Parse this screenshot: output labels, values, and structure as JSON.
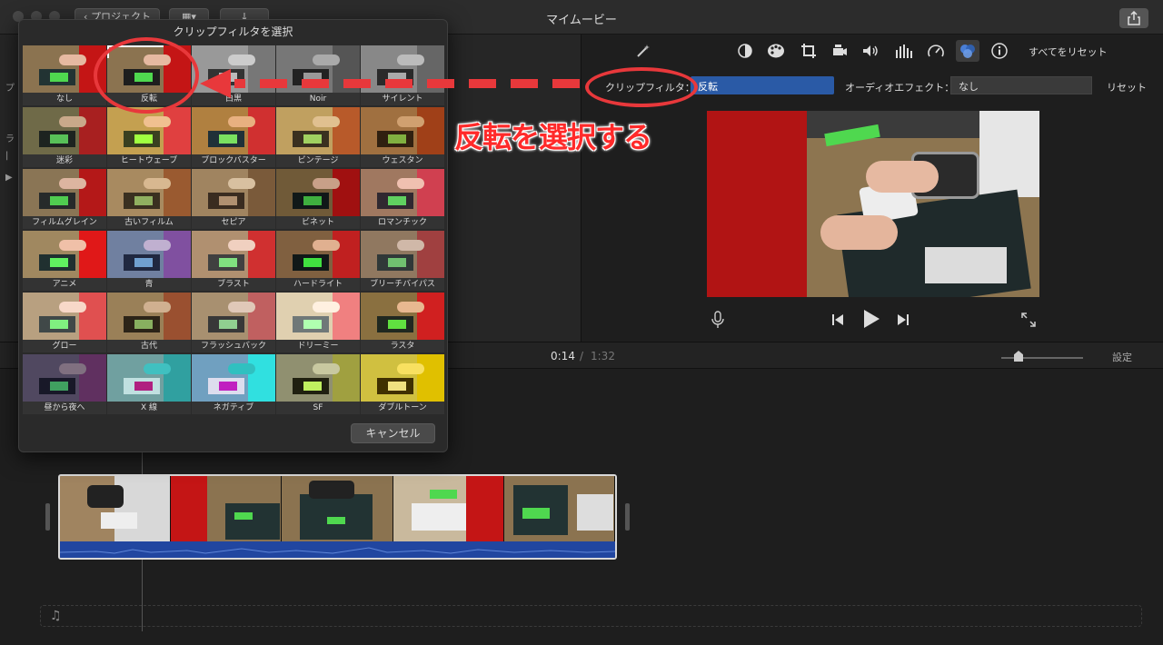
{
  "window": {
    "title": "マイムービー",
    "project_button": "プロジェクト"
  },
  "browser": {
    "side_labels": [
      "プ",
      "ラ",
      "|"
    ]
  },
  "toolbar": {
    "reset_all": "すべてをリセット",
    "icons": [
      "magic-wand-icon",
      "color-balance-icon",
      "color-palette-icon",
      "crop-icon",
      "stabilization-icon",
      "volume-icon",
      "equalizer-icon",
      "speed-icon",
      "clip-filter-icon",
      "info-icon"
    ]
  },
  "filter_bar": {
    "clip_filter_label": "クリップフィルタ：",
    "clip_filter_value": "反転",
    "audio_effect_label": "オーディオエフェクト：",
    "audio_effect_value": "なし",
    "reset_label": "リセット"
  },
  "timeline": {
    "current_time": "0:14",
    "separator": "/",
    "total_time": "1:32",
    "settings_label": "設定"
  },
  "modal": {
    "title": "クリップフィルタを選択",
    "cancel_label": "キャンセル",
    "filters": [
      "なし",
      "反転",
      "白黒",
      "Noir",
      "サイレント",
      "迷彩",
      "ヒートウェーブ",
      "ブロックバスター",
      "ビンテージ",
      "ウェスタン",
      "フィルムグレイン",
      "古いフィルム",
      "セピア",
      "ビネット",
      "ロマンチック",
      "アニメ",
      "青",
      "ブラスト",
      "ハードライト",
      "ブリーチバイパス",
      "グロー",
      "古代",
      "フラッシュバック",
      "ドリーミー",
      "ラスタ",
      "昼から夜へ",
      "X 線",
      "ネガティブ",
      "SF",
      "ダブルトーン"
    ],
    "selected": "反転"
  },
  "annotation": {
    "text": "反転を選択する"
  },
  "colors": {
    "accent_blue": "#2a5aa6",
    "annotation_red": "#e8383b"
  }
}
